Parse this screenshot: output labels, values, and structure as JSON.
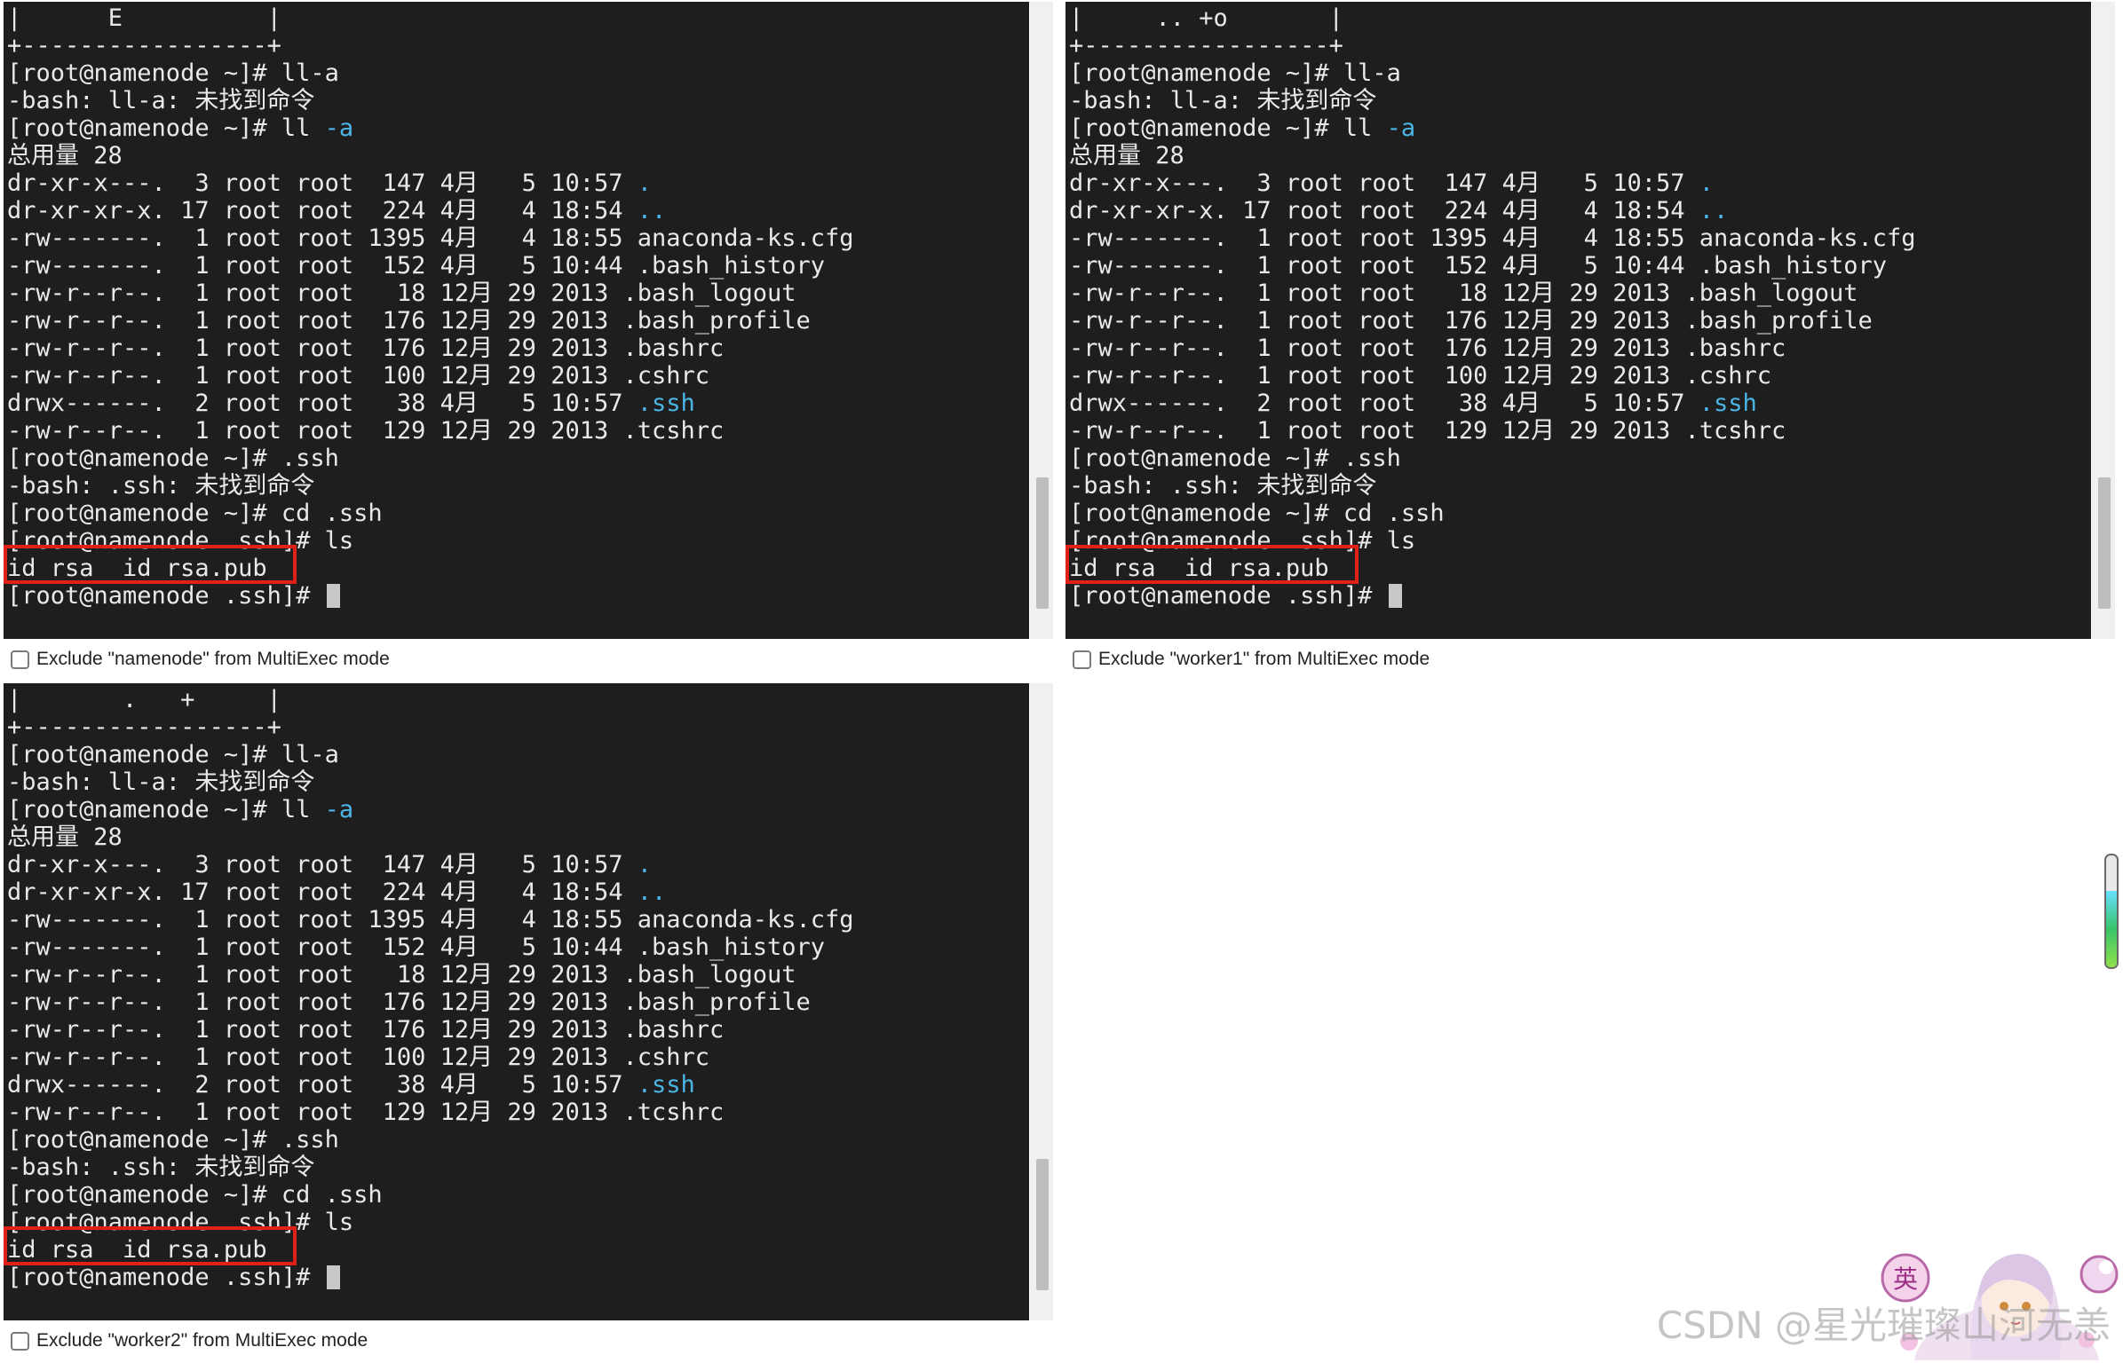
{
  "panes": [
    {
      "exclude_label": "Exclude \"namenode\" from MultiExec mode",
      "lines": [
        [
          {
            "t": "|      E          |"
          }
        ],
        [
          {
            "t": "+-----------------+"
          }
        ],
        [
          {
            "t": "[root@namenode ~]# ll-a"
          }
        ],
        [
          {
            "t": "-bash: ll-a: 未找到命令"
          }
        ],
        [
          {
            "t": "[root@namenode ~]# ll "
          },
          {
            "t": "-a",
            "c": "blue"
          }
        ],
        [
          {
            "t": "总用量 28"
          }
        ],
        [
          {
            "t": "dr-xr-x---.  3 root root  147 4月   5 10:57 "
          },
          {
            "t": ".",
            "c": "blue"
          }
        ],
        [
          {
            "t": "dr-xr-xr-x. 17 root root  224 4月   4 18:54 "
          },
          {
            "t": "..",
            "c": "blue"
          }
        ],
        [
          {
            "t": "-rw-------.  1 root root 1395 4月   4 18:55 anaconda-ks.cfg"
          }
        ],
        [
          {
            "t": "-rw-------.  1 root root  152 4月   5 10:44 .bash_history"
          }
        ],
        [
          {
            "t": "-rw-r--r--.  1 root root   18 12月 29 2013 .bash_logout"
          }
        ],
        [
          {
            "t": "-rw-r--r--.  1 root root  176 12月 29 2013 .bash_profile"
          }
        ],
        [
          {
            "t": "-rw-r--r--.  1 root root  176 12月 29 2013 .bashrc"
          }
        ],
        [
          {
            "t": "-rw-r--r--.  1 root root  100 12月 29 2013 .cshrc"
          }
        ],
        [
          {
            "t": "drwx------.  2 root root   38 4月   5 10:57 "
          },
          {
            "t": ".ssh",
            "c": "blue"
          }
        ],
        [
          {
            "t": "-rw-r--r--.  1 root root  129 12月 29 2013 .tcshrc"
          }
        ],
        [
          {
            "t": "[root@namenode ~]# .ssh"
          }
        ],
        [
          {
            "t": "-bash: .ssh: 未找到命令"
          }
        ],
        [
          {
            "t": "[root@namenode ~]# cd .ssh"
          }
        ],
        [
          {
            "t": "[root@namenode .ssh]# ls"
          }
        ],
        [
          {
            "t": "id_rsa  id_rsa.pub"
          }
        ],
        [
          {
            "t": "[root@namenode .ssh]# "
          }
        ]
      ]
    },
    {
      "exclude_label": "Exclude \"worker1\" from MultiExec mode",
      "lines": [
        [
          {
            "t": "|     .. +o       |"
          }
        ],
        [
          {
            "t": "+-----------------+"
          }
        ],
        [
          {
            "t": "[root@namenode ~]# ll-a"
          }
        ],
        [
          {
            "t": "-bash: ll-a: 未找到命令"
          }
        ],
        [
          {
            "t": "[root@namenode ~]# ll "
          },
          {
            "t": "-a",
            "c": "blue"
          }
        ],
        [
          {
            "t": "总用量 28"
          }
        ],
        [
          {
            "t": "dr-xr-x---.  3 root root  147 4月   5 10:57 "
          },
          {
            "t": ".",
            "c": "blue"
          }
        ],
        [
          {
            "t": "dr-xr-xr-x. 17 root root  224 4月   4 18:54 "
          },
          {
            "t": "..",
            "c": "blue"
          }
        ],
        [
          {
            "t": "-rw-------.  1 root root 1395 4月   4 18:55 anaconda-ks.cfg"
          }
        ],
        [
          {
            "t": "-rw-------.  1 root root  152 4月   5 10:44 .bash_history"
          }
        ],
        [
          {
            "t": "-rw-r--r--.  1 root root   18 12月 29 2013 .bash_logout"
          }
        ],
        [
          {
            "t": "-rw-r--r--.  1 root root  176 12月 29 2013 .bash_profile"
          }
        ],
        [
          {
            "t": "-rw-r--r--.  1 root root  176 12月 29 2013 .bashrc"
          }
        ],
        [
          {
            "t": "-rw-r--r--.  1 root root  100 12月 29 2013 .cshrc"
          }
        ],
        [
          {
            "t": "drwx------.  2 root root   38 4月   5 10:57 "
          },
          {
            "t": ".ssh",
            "c": "blue"
          }
        ],
        [
          {
            "t": "-rw-r--r--.  1 root root  129 12月 29 2013 .tcshrc"
          }
        ],
        [
          {
            "t": "[root@namenode ~]# .ssh"
          }
        ],
        [
          {
            "t": "-bash: .ssh: 未找到命令"
          }
        ],
        [
          {
            "t": "[root@namenode ~]# cd .ssh"
          }
        ],
        [
          {
            "t": "[root@namenode .ssh]# ls"
          }
        ],
        [
          {
            "t": "id_rsa  id_rsa.pub"
          }
        ],
        [
          {
            "t": "[root@namenode .ssh]# "
          }
        ]
      ]
    },
    {
      "exclude_label": "Exclude \"worker2\" from MultiExec mode",
      "lines": [
        [
          {
            "t": "|       .   +     |"
          }
        ],
        [
          {
            "t": "+-----------------+"
          }
        ],
        [
          {
            "t": "[root@namenode ~]# ll-a"
          }
        ],
        [
          {
            "t": "-bash: ll-a: 未找到命令"
          }
        ],
        [
          {
            "t": "[root@namenode ~]# ll "
          },
          {
            "t": "-a",
            "c": "blue"
          }
        ],
        [
          {
            "t": "总用量 28"
          }
        ],
        [
          {
            "t": "dr-xr-x---.  3 root root  147 4月   5 10:57 "
          },
          {
            "t": ".",
            "c": "blue"
          }
        ],
        [
          {
            "t": "dr-xr-xr-x. 17 root root  224 4月   4 18:54 "
          },
          {
            "t": "..",
            "c": "blue"
          }
        ],
        [
          {
            "t": "-rw-------.  1 root root 1395 4月   4 18:55 anaconda-ks.cfg"
          }
        ],
        [
          {
            "t": "-rw-------.  1 root root  152 4月   5 10:44 .bash_history"
          }
        ],
        [
          {
            "t": "-rw-r--r--.  1 root root   18 12月 29 2013 .bash_logout"
          }
        ],
        [
          {
            "t": "-rw-r--r--.  1 root root  176 12月 29 2013 .bash_profile"
          }
        ],
        [
          {
            "t": "-rw-r--r--.  1 root root  176 12月 29 2013 .bashrc"
          }
        ],
        [
          {
            "t": "-rw-r--r--.  1 root root  100 12月 29 2013 .cshrc"
          }
        ],
        [
          {
            "t": "drwx------.  2 root root   38 4月   5 10:57 "
          },
          {
            "t": ".ssh",
            "c": "blue"
          }
        ],
        [
          {
            "t": "-rw-r--r--.  1 root root  129 12月 29 2013 .tcshrc"
          }
        ],
        [
          {
            "t": "[root@namenode ~]# .ssh"
          }
        ],
        [
          {
            "t": "-bash: .ssh: 未找到命令"
          }
        ],
        [
          {
            "t": "[root@namenode ~]# cd .ssh"
          }
        ],
        [
          {
            "t": "[root@namenode .ssh]# ls"
          }
        ],
        [
          {
            "t": "id_rsa  id_rsa.pub"
          }
        ],
        [
          {
            "t": "[root@namenode .ssh]# "
          }
        ]
      ]
    }
  ],
  "colors": {
    "terminal_bg": "#1e1e1e",
    "terminal_fg": "#e9e9e9",
    "link_blue": "#4bb6e6",
    "highlight_red": "#e0201b"
  },
  "mascot": {
    "badge_text": "英"
  },
  "watermark": "CSDN @星光璀璨山河无恙"
}
